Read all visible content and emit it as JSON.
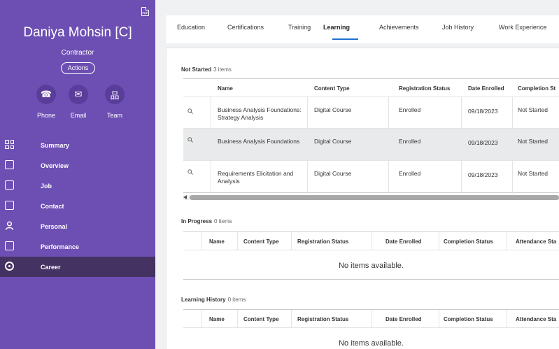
{
  "profile": {
    "name": "Daniya Mohsin [C]",
    "role": "Contractor",
    "actions_label": "Actions",
    "pdf_label": "PDF",
    "quick_actions": [
      {
        "label": "Phone",
        "icon": "phone-icon",
        "glyph": "☎"
      },
      {
        "label": "Email",
        "icon": "email-icon",
        "glyph": "✉"
      },
      {
        "label": "Team",
        "icon": "team-icon",
        "glyph": "品"
      }
    ]
  },
  "nav": {
    "items": [
      {
        "label": "Summary",
        "icon": "summary-grid-icon"
      },
      {
        "label": "Overview",
        "icon": "overview-icon"
      },
      {
        "label": "Job",
        "icon": "job-briefcase-icon"
      },
      {
        "label": "Contact",
        "icon": "contact-card-icon"
      },
      {
        "label": "Personal",
        "icon": "person-icon"
      },
      {
        "label": "Performance",
        "icon": "performance-clipboard-icon"
      },
      {
        "label": "Career",
        "icon": "career-target-icon",
        "active": true
      }
    ]
  },
  "tabs": [
    "Education",
    "Certifications",
    "Training",
    "Learning",
    "Achievements",
    "Job History",
    "Work Experience"
  ],
  "active_tab": "Learning",
  "not_started": {
    "title": "Not Started",
    "count": "3 items",
    "headers": [
      "Name",
      "Content Type",
      "Registration Status",
      "Date Enrolled",
      "Completion St"
    ],
    "rows": [
      {
        "name": "Business Analysis Foundations: Strategy Analysis",
        "content_type": "Digital Course",
        "registration": "Enrolled",
        "date": "09/18/2023",
        "completion": "Not Started"
      },
      {
        "name": "Business Analysis Foundations",
        "content_type": "Digital Course",
        "registration": "Enrolled",
        "date": "09/18/2023",
        "completion": "Not Started"
      },
      {
        "name": "Requirements Elicitation and Analysis",
        "content_type": "Digital Course",
        "registration": "Enrolled",
        "date": "09/18/2023",
        "completion": "Not Started"
      }
    ]
  },
  "in_progress": {
    "title": "In Progress",
    "count": "0 items",
    "headers": [
      "Name",
      "Content Type",
      "Registration Status",
      "Date Enrolled",
      "Completion Status",
      "Attendance Sta"
    ],
    "empty": "No items available."
  },
  "learning_history": {
    "title": "Learning History",
    "count": "0 items",
    "headers": [
      "Name",
      "Content Type",
      "Registration Status",
      "Date Enrolled",
      "Completion Status",
      "Attendance Sta"
    ],
    "empty": "No items available."
  },
  "colors": {
    "sidebar": "#6d4fb3",
    "sidebar_active": "#443263",
    "link": "#1e5fb8",
    "tab_underline": "#1e6fcf"
  }
}
